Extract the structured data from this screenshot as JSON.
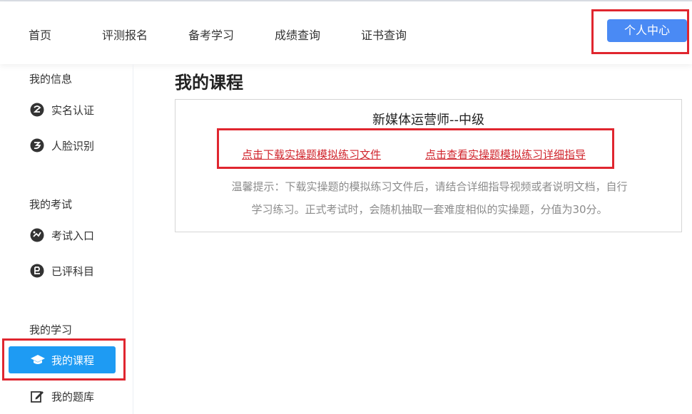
{
  "nav": {
    "items": [
      "首页",
      "评测报名",
      "备考学习",
      "成绩查询",
      "证书查询"
    ],
    "user_center": "个人中心"
  },
  "sidebar": {
    "groups": [
      {
        "title": "我的信息",
        "items": [
          {
            "label": "实名认证",
            "icon": "verify-icon"
          },
          {
            "label": "人脸识别",
            "icon": "face-icon"
          }
        ]
      },
      {
        "title": "我的考试",
        "items": [
          {
            "label": "考试入口",
            "icon": "exam-entry-icon"
          },
          {
            "label": "已评科目",
            "icon": "graded-icon"
          }
        ]
      },
      {
        "title": "我的学习",
        "items": [
          {
            "label": "我的课程",
            "icon": "graduation-cap-icon",
            "active": true
          },
          {
            "label": "我的题库",
            "icon": "edit-icon"
          }
        ]
      }
    ]
  },
  "main": {
    "title": "我的课程",
    "course": {
      "name": "新媒体运营师--中级",
      "download_link": "点击下载实操题模拟练习文件",
      "guide_link": "点击查看实操题模拟练习详细指导",
      "tip_line1": "温馨提示：下载实操题的模拟练习文件后，请结合详细指导视频或者说明文档，自行",
      "tip_line2": "学习练习。正式考试时，会随机抽取一套难度相似的实操题，分值为30分。"
    }
  },
  "colors": {
    "accent": "#4a8af4",
    "active": "#1e9bf3",
    "link": "#d0242c",
    "highlight": "#e0262f"
  }
}
